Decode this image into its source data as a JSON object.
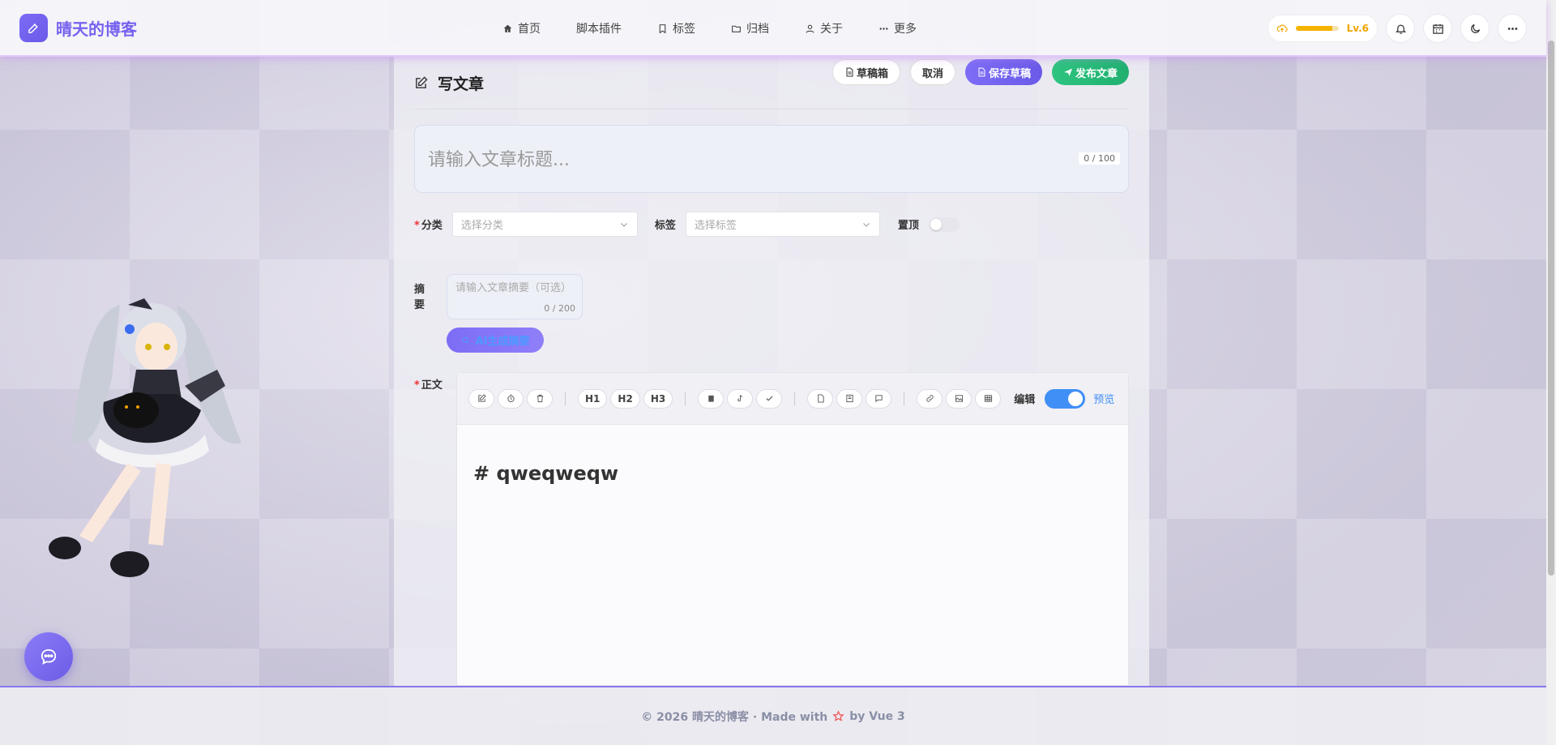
{
  "brand": {
    "name": "晴天的博客",
    "accent": "#7562ee"
  },
  "nav": [
    {
      "label": "首页",
      "icon": "home-icon"
    },
    {
      "label": "脚本插件",
      "icon": ""
    },
    {
      "label": "标签",
      "icon": "tag-icon"
    },
    {
      "label": "归档",
      "icon": "folder-icon"
    },
    {
      "label": "关于",
      "icon": "user-icon"
    },
    {
      "label": "更多",
      "icon": "dots-icon"
    }
  ],
  "header": {
    "level": "Lv.6",
    "level_progress": 0.85
  },
  "page": {
    "title": "写文章",
    "actions": {
      "drafts": "草稿箱",
      "cancel": "取消",
      "save": "保存草稿",
      "publish": "发布文章"
    }
  },
  "form": {
    "title_placeholder": "请输入文章标题...",
    "title_count": "0 / 100",
    "category_label": "分类",
    "category_placeholder": "选择分类",
    "tags_label": "标签",
    "tags_placeholder": "选择标签",
    "pin_label": "置顶",
    "summary_label": "摘要",
    "summary_placeholder": "请输入文章摘要（可选）",
    "summary_count": "0 / 200",
    "ai_button": "AI生成摘要",
    "content_label": "正文"
  },
  "editor": {
    "heading_buttons": [
      "H1",
      "H2",
      "H3"
    ],
    "edit_label": "编辑",
    "preview_label": "预览",
    "content": "# qweqweqw"
  },
  "footer": {
    "prefix": "© 2026 晴天的博客 · Made with",
    "suffix": "by Vue 3"
  }
}
